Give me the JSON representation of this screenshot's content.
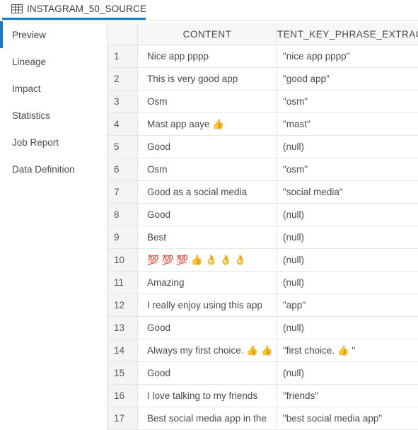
{
  "tab": {
    "icon": "table-grid-icon",
    "title": "INSTAGRAM_50_SOURCE",
    "accent_color": "#0b7fd4"
  },
  "sidebar": {
    "items": [
      {
        "label": "Preview",
        "selected": true
      },
      {
        "label": "Lineage",
        "selected": false
      },
      {
        "label": "Impact",
        "selected": false
      },
      {
        "label": "Statistics",
        "selected": false
      },
      {
        "label": "Job Report",
        "selected": false
      },
      {
        "label": "Data Definition",
        "selected": false
      }
    ]
  },
  "grid": {
    "columns": [
      {
        "key": "rownum",
        "label": ""
      },
      {
        "key": "content",
        "label": "CONTENT"
      },
      {
        "key": "keyphrase",
        "label": "TENT_KEY_PHRASE_EXTRACTION"
      }
    ],
    "rows": [
      {
        "num": "1",
        "content": "Nice app pppp",
        "keyphrase": "\"nice app pppp\"",
        "null": false
      },
      {
        "num": "2",
        "content": "This is very good app",
        "keyphrase": "\"good app\"",
        "null": false
      },
      {
        "num": "3",
        "content": "Osm",
        "keyphrase": "\"osm\"",
        "null": false
      },
      {
        "num": "4",
        "content": "Mast app aaye 👍",
        "keyphrase": "\"mast\"",
        "null": false
      },
      {
        "num": "5",
        "content": "Good",
        "keyphrase": "(null)",
        "null": true
      },
      {
        "num": "6",
        "content": "Osm",
        "keyphrase": "\"osm\"",
        "null": false
      },
      {
        "num": "7",
        "content": "Good as a social media",
        "keyphrase": "\"social media\"",
        "null": false
      },
      {
        "num": "8",
        "content": "Good",
        "keyphrase": "(null)",
        "null": true
      },
      {
        "num": "9",
        "content": "Best",
        "keyphrase": "(null)",
        "null": true
      },
      {
        "num": "10",
        "content": "💯 💯 💯 👍 👌 👌 👌",
        "keyphrase": "(null)",
        "null": true
      },
      {
        "num": "11",
        "content": "Amazing",
        "keyphrase": "(null)",
        "null": true
      },
      {
        "num": "12",
        "content": "I really enjoy using this app",
        "keyphrase": "\"app\"",
        "null": false
      },
      {
        "num": "13",
        "content": "Good",
        "keyphrase": "(null)",
        "null": true
      },
      {
        "num": "14",
        "content": "Always my first choice. 👍 👍",
        "keyphrase": "\"first choice. 👍 \"",
        "null": false
      },
      {
        "num": "15",
        "content": "Good",
        "keyphrase": "(null)",
        "null": true
      },
      {
        "num": "16",
        "content": "I love talking to my friends",
        "keyphrase": "\"friends\"",
        "null": false
      },
      {
        "num": "17",
        "content": "Best social media app in the",
        "keyphrase": "\"best social media app\"",
        "null": false
      }
    ]
  }
}
